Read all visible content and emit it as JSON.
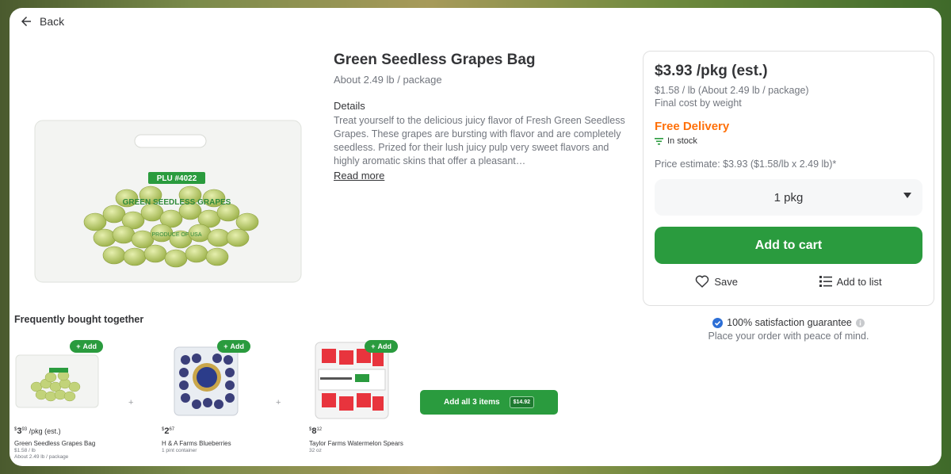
{
  "nav": {
    "back_label": "Back"
  },
  "product": {
    "title": "Green Seedless Grapes Bag",
    "size": "About 2.49 lb / package",
    "details_heading": "Details",
    "details_text": "Treat yourself to the delicious juicy flavor of Fresh Green Seedless Grapes. These grapes are bursting with flavor and are completely seedless. Prized for their lush juicy pulp very sweet flavors and highly aromatic skins that offer a pleasant…",
    "read_more": "Read more",
    "bag_label": "PLU #4022",
    "bag_text": "GREEN SEEDLESS GRAPES",
    "bag_origin": "PRODUCE OF USA"
  },
  "panel": {
    "price": "$3.93 /pkg (est.)",
    "unit_price": "$1.58 / lb (About 2.49 lb / package)",
    "final_cost": "Final cost by weight",
    "delivery": "Free Delivery",
    "stock": "In stock",
    "estimate": "Price estimate: $3.93 ($1.58/lb x 2.49 lb)*",
    "quantity": "1 pkg",
    "add_to_cart": "Add to cart",
    "save": "Save",
    "add_to_list": "Add to list"
  },
  "guarantee": {
    "title": "100% satisfaction guarantee",
    "subtitle": "Place your order with peace of mind."
  },
  "fbt": {
    "heading": "Frequently bought together",
    "add_label": "Add",
    "plus": "+",
    "items": [
      {
        "dollars": "3",
        "cents": "93",
        "suffix": "/pkg (est.)",
        "name": "Green Seedless Grapes Bag",
        "meta1": "$1.58 / lb",
        "meta2": "About 2.49 lb / package"
      },
      {
        "dollars": "2",
        "cents": "67",
        "suffix": "",
        "name": "H & A Farms Blueberries",
        "meta1": "1 pint container",
        "meta2": ""
      },
      {
        "dollars": "8",
        "cents": "12",
        "suffix": "",
        "name": "Taylor Farms Watermelon Spears",
        "meta1": "32 oz",
        "meta2": ""
      }
    ],
    "add_all": "Add all 3 items",
    "add_all_total": "$14.92"
  },
  "colors": {
    "green": "#2a9b3e",
    "orange": "#ff7009",
    "text": "#343538",
    "muted": "#72767e"
  }
}
